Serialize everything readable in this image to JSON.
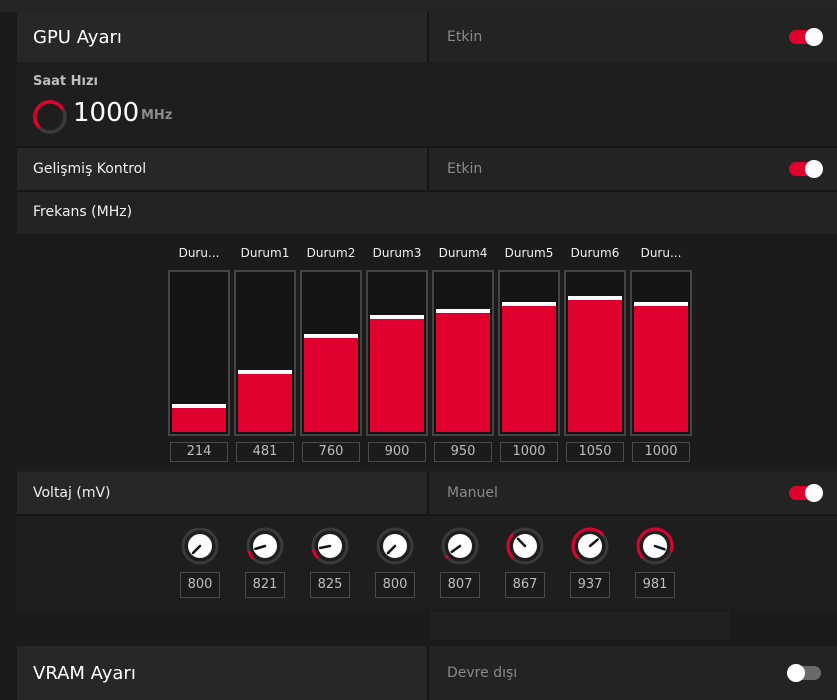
{
  "gpu": {
    "title": "GPU Ayarı",
    "status": "Etkin",
    "enabled": true
  },
  "clock": {
    "label": "Saat Hızı",
    "value": "1000",
    "unit": "MHz"
  },
  "advanced": {
    "title": "Gelişmiş Kontrol",
    "status": "Etkin",
    "enabled": true
  },
  "frequency": {
    "title": "Frekans (MHz)",
    "states": [
      {
        "label": "Duru...",
        "value": 214,
        "display": "214"
      },
      {
        "label": "Durum1",
        "value": 481,
        "display": "481"
      },
      {
        "label": "Durum2",
        "value": 760,
        "display": "760"
      },
      {
        "label": "Durum3",
        "value": 900,
        "display": "900"
      },
      {
        "label": "Durum4",
        "value": 950,
        "display": "950"
      },
      {
        "label": "Durum5",
        "value": 1000,
        "display": "1000"
      },
      {
        "label": "Durum6",
        "value": 1050,
        "display": "1050"
      },
      {
        "label": "Duru...",
        "value": 1000,
        "display": "1000"
      }
    ]
  },
  "voltage": {
    "title": "Voltaj (mV)",
    "status": "Manuel",
    "enabled": true,
    "values": [
      {
        "value": 800,
        "display": "800"
      },
      {
        "value": 821,
        "display": "821"
      },
      {
        "value": 825,
        "display": "825"
      },
      {
        "value": 800,
        "display": "800"
      },
      {
        "value": 807,
        "display": "807"
      },
      {
        "value": 867,
        "display": "867"
      },
      {
        "value": 937,
        "display": "937"
      },
      {
        "value": 981,
        "display": "981"
      }
    ]
  },
  "vram": {
    "title": "VRAM Ayarı",
    "status": "Devre dışı",
    "enabled": false
  },
  "colors": {
    "accent": "#e0002e",
    "toggle_off": "#6a6a6a"
  }
}
